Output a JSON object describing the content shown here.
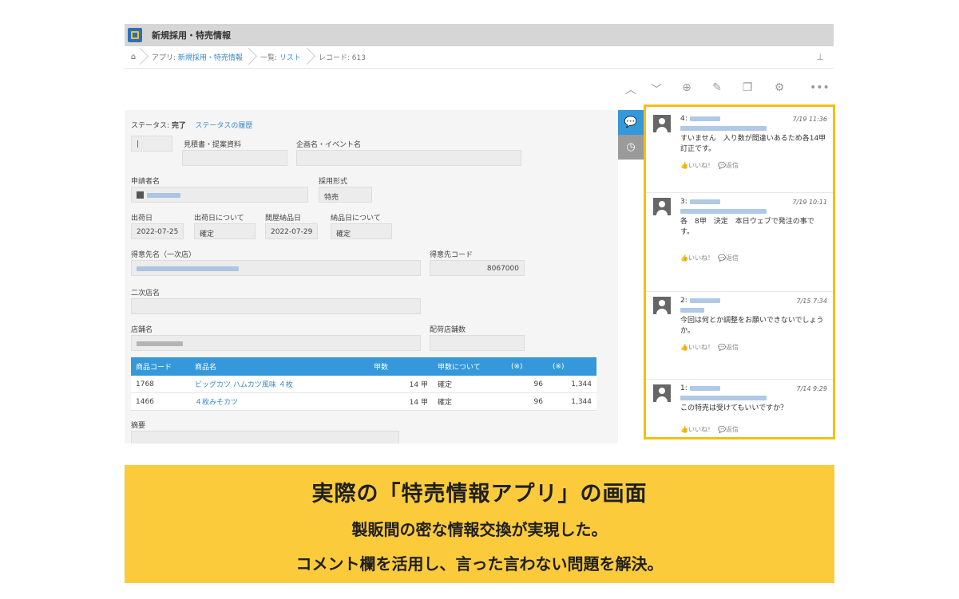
{
  "app": {
    "title": "新規採用・特売情報"
  },
  "breadcrumb": {
    "app_prefix": "アプリ:",
    "app_link": "新規採用・特売情報",
    "list_prefix": "一覧:",
    "list_link": "リスト",
    "record": "レコード: 613"
  },
  "status": {
    "label": "ステータス:",
    "value": "完了",
    "history_link": "ステータスの履歴"
  },
  "fields": {
    "estimate_label": "見積書・提案資料",
    "event_label": "企画名・イベント名",
    "applicant_label": "申請者名",
    "adoption_label": "採用形式",
    "adoption_value": "特売",
    "ship_date_label": "出荷日",
    "ship_note_label": "出荷日について",
    "ship_date_value": "2022-07-25",
    "ship_note_value": "確定",
    "store_delivery_label": "間屋納品日",
    "store_delivery_value": "2022-07-29",
    "delivery_note_label": "納品日について",
    "delivery_note_value": "確定",
    "customer_label": "得意先名（一次店）",
    "customer_code_label": "得意先コード",
    "customer_code_value": "8067000",
    "secondary_label": "二次店名",
    "store_label": "店舗名",
    "store_count_label": "配荷店舗数",
    "summary_label": "摘要"
  },
  "table": {
    "headers": [
      "商品コード",
      "商品名",
      "甲数",
      "甲数について",
      "(※)",
      "(※)"
    ],
    "rows": [
      {
        "code": "1768",
        "name": "ビッグカツ ハムカツ風味 ４枚",
        "qty": "14 甲",
        "note": "確定",
        "a": "96",
        "b": "1,344"
      },
      {
        "code": "1466",
        "name": "４枚みそカツ",
        "qty": "14 甲",
        "note": "確定",
        "a": "96",
        "b": "1,344"
      }
    ]
  },
  "comments": [
    {
      "num": "4:",
      "time": "7/19 11:36",
      "text": "すいません　入り数が間違いあるため各14甲訂正です。",
      "like": "いいね！",
      "reply": "返信"
    },
    {
      "num": "3:",
      "time": "7/19 10:11",
      "text": "各　8甲　決定　本日ウェブで発注の事です。",
      "like": "いいね！",
      "reply": "返信"
    },
    {
      "num": "2:",
      "time": "7/15 7:34",
      "text": "今回は何とか調整をお願いできないでしょうか。",
      "like": "いいね！",
      "reply": "返信"
    },
    {
      "num": "1:",
      "time": "7/14 9:29",
      "text": "この特売は受けてもいいですか？",
      "like": "いいね！",
      "reply": "返信"
    }
  ],
  "banner": {
    "line1": "実際の「特売情報アプリ」の画面",
    "line2": "製販間の密な情報交換が実現した。",
    "line3": "コメント欄を活用し、言った言わない問題を解決。"
  },
  "colors": {
    "accent": "#3498db",
    "highlight": "#f5be16",
    "banner": "#fbcb3c"
  }
}
